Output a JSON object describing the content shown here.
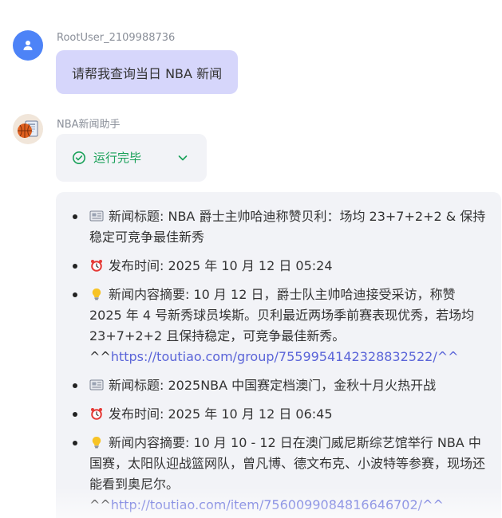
{
  "user_message": {
    "sender": "RootUser_2109988736",
    "text": "请帮我查询当日 NBA 新闻"
  },
  "bot_message": {
    "sender": "NBA新闻助手",
    "status": {
      "label": "运行完毕",
      "icon": "check-circle-icon",
      "color": "#18a058"
    },
    "items": [
      {
        "icon": "newspaper-icon",
        "text": "新闻标题: NBA 爵士主帅哈迪称赞贝利：场均 23+7+2+2 & 保持稳定可竞争最佳新秀"
      },
      {
        "icon": "alarm-clock-icon",
        "text": "发布时间: 2025 年 10 月 12 日 05:24"
      },
      {
        "icon": "light-bulb-icon",
        "text": "新闻内容摘要: 10 月 12 日，爵士队主帅哈迪接受采访，称赞 2025 年 4 号新秀球员埃斯。贝利最近两场季前赛表现优秀，若场均 23+7+2+2 且保持稳定，可竞争最佳新秀。",
        "link_prefix": "^^",
        "link": "https://toutiao.com/group/7559954142328832522/",
        "link_suffix": "^^"
      },
      {
        "icon": "newspaper-icon",
        "text": "新闻标题: 2025NBA 中国赛定档澳门，金秋十月火热开战"
      },
      {
        "icon": "alarm-clock-icon",
        "text": "发布时间: 2025 年 10 月 12 日 06:45"
      },
      {
        "icon": "light-bulb-icon",
        "text": "新闻内容摘要: 10 月 10 - 12 日在澳门威尼斯综艺馆举行 NBA 中国赛，太阳队迎战篮网队，曾凡博、德文布克、小波特等参赛，现场还能看到奥尼尔。",
        "link_prefix": "^^",
        "link": "http://toutiao.com/item/7560099084816646702/",
        "link_suffix": "^^"
      }
    ]
  },
  "colors": {
    "user_avatar": "#4d83f7",
    "user_bubble": "#d6d6fb",
    "bot_panel": "#f2f3f7",
    "link": "#5a64d8"
  }
}
